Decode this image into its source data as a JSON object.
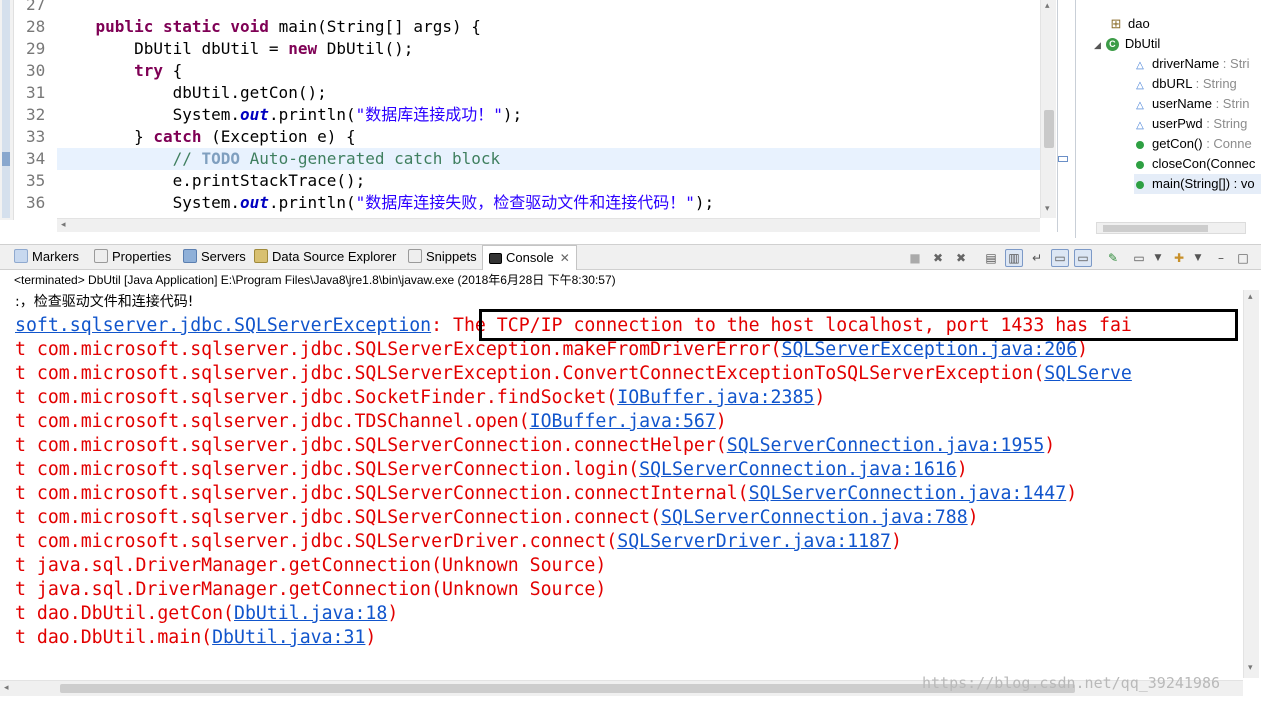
{
  "editor": {
    "line_numbers": [
      "27",
      "28",
      "29",
      "30",
      "31",
      "32",
      "33",
      "34",
      "35",
      "36"
    ],
    "lines": [
      {
        "indent": "",
        "parts": []
      },
      {
        "indent": "    ",
        "parts": [
          {
            "t": "kw",
            "v": "public"
          },
          {
            "t": "p",
            "v": " "
          },
          {
            "t": "kw",
            "v": "static"
          },
          {
            "t": "p",
            "v": " "
          },
          {
            "t": "kw",
            "v": "void"
          },
          {
            "t": "p",
            "v": " main(String[] args) {"
          }
        ]
      },
      {
        "indent": "        ",
        "parts": [
          {
            "t": "p",
            "v": "DbUtil dbUtil = "
          },
          {
            "t": "kw",
            "v": "new"
          },
          {
            "t": "p",
            "v": " DbUtil();"
          }
        ]
      },
      {
        "indent": "        ",
        "parts": [
          {
            "t": "kw",
            "v": "try"
          },
          {
            "t": "p",
            "v": " {"
          }
        ]
      },
      {
        "indent": "            ",
        "parts": [
          {
            "t": "p",
            "v": "dbUtil.getCon();"
          }
        ]
      },
      {
        "indent": "            ",
        "parts": [
          {
            "t": "p",
            "v": "System."
          },
          {
            "t": "st",
            "v": "out"
          },
          {
            "t": "p",
            "v": ".println("
          },
          {
            "t": "str",
            "v": "\"数据库连接成功！\""
          },
          {
            "t": "p",
            "v": ");"
          }
        ]
      },
      {
        "indent": "        ",
        "parts": [
          {
            "t": "p",
            "v": "} "
          },
          {
            "t": "kw",
            "v": "catch"
          },
          {
            "t": "p",
            "v": " (Exception e) {"
          }
        ]
      },
      {
        "indent": "            ",
        "parts": [
          {
            "t": "cm",
            "v": "// "
          },
          {
            "t": "todo",
            "v": "TODO"
          },
          {
            "t": "cm",
            "v": " Auto-generated catch block"
          }
        ]
      },
      {
        "indent": "            ",
        "parts": [
          {
            "t": "p",
            "v": "e.printStackTrace();"
          }
        ]
      },
      {
        "indent": "            ",
        "parts": [
          {
            "t": "p",
            "v": "System."
          },
          {
            "t": "st",
            "v": "out"
          },
          {
            "t": "p",
            "v": ".println("
          },
          {
            "t": "str",
            "v": "\"数据库连接失败，检查驱动文件和连接代码！\""
          },
          {
            "t": "p",
            "v": ");"
          }
        ]
      }
    ]
  },
  "outline": {
    "package": "dao",
    "class": "DbUtil",
    "members": [
      {
        "name": "driverName",
        "type": " : Stri",
        "kind": "field"
      },
      {
        "name": "dbURL",
        "type": " : String",
        "kind": "field"
      },
      {
        "name": "userName",
        "type": " : Strin",
        "kind": "field"
      },
      {
        "name": "userPwd",
        "type": " : String",
        "kind": "field"
      },
      {
        "name": "getCon()",
        "type": " : Conne",
        "kind": "method"
      },
      {
        "name": "closeCon(Connec",
        "type": "",
        "kind": "method"
      },
      {
        "name": "main(String[]) : vo",
        "type": "",
        "kind": "static-method"
      }
    ]
  },
  "tabs": {
    "markers": "Markers",
    "properties": "Properties",
    "servers": "Servers",
    "data_source_explorer": "Data Source Explorer",
    "snippets": "Snippets",
    "console": "Console"
  },
  "console": {
    "status": "<terminated> DbUtil [Java Application] E:\\Program Files\\Java8\\jre1.8\\bin\\javaw.exe (2018年6月28日 下午8:30:57)",
    "first_line": ":，检查驱动文件和连接代码!",
    "exception_class": "soft.sqlserver.jdbc.SQLServerException",
    "exception_sep": ":",
    "exception_message": " The TCP/IP connection to the host localhost, port 1433 has fai",
    "stack": [
      {
        "prefix": "t com.microsoft.sqlserver.jdbc.SQLServerException.makeFromDriverError(",
        "link": "SQLServerException.java:206",
        "suffix": ")"
      },
      {
        "prefix": "t com.microsoft.sqlserver.jdbc.SQLServerException.ConvertConnectExceptionToSQLServerException(",
        "link": "SQLServe",
        "suffix": ""
      },
      {
        "prefix": "t com.microsoft.sqlserver.jdbc.SocketFinder.findSocket(",
        "link": "IOBuffer.java:2385",
        "suffix": ")"
      },
      {
        "prefix": "t com.microsoft.sqlserver.jdbc.TDSChannel.open(",
        "link": "IOBuffer.java:567",
        "suffix": ")"
      },
      {
        "prefix": "t com.microsoft.sqlserver.jdbc.SQLServerConnection.connectHelper(",
        "link": "SQLServerConnection.java:1955",
        "suffix": ")"
      },
      {
        "prefix": "t com.microsoft.sqlserver.jdbc.SQLServerConnection.login(",
        "link": "SQLServerConnection.java:1616",
        "suffix": ")"
      },
      {
        "prefix": "t com.microsoft.sqlserver.jdbc.SQLServerConnection.connectInternal(",
        "link": "SQLServerConnection.java:1447",
        "suffix": ")"
      },
      {
        "prefix": "t com.microsoft.sqlserver.jdbc.SQLServerConnection.connect(",
        "link": "SQLServerConnection.java:788",
        "suffix": ")"
      },
      {
        "prefix": "t com.microsoft.sqlserver.jdbc.SQLServerDriver.connect(",
        "link": "SQLServerDriver.java:1187",
        "suffix": ")"
      },
      {
        "prefix": "t java.sql.DriverManager.getConnection(Unknown Source)",
        "link": "",
        "suffix": ""
      },
      {
        "prefix": "t java.sql.DriverManager.getConnection(Unknown Source)",
        "link": "",
        "suffix": ""
      },
      {
        "prefix": "t dao.DbUtil.getCon(",
        "link": "DbUtil.java:18",
        "suffix": ")"
      },
      {
        "prefix": "t dao.DbUtil.main(",
        "link": "DbUtil.java:31",
        "suffix": ")"
      }
    ]
  },
  "watermark": "https://blog.csdn.net/qq_39241986",
  "colors": {
    "keyword": "#7f0055",
    "string": "#2a00ff",
    "comment": "#3f7f5f",
    "error_text": "#e20000",
    "link": "#1155cc"
  }
}
